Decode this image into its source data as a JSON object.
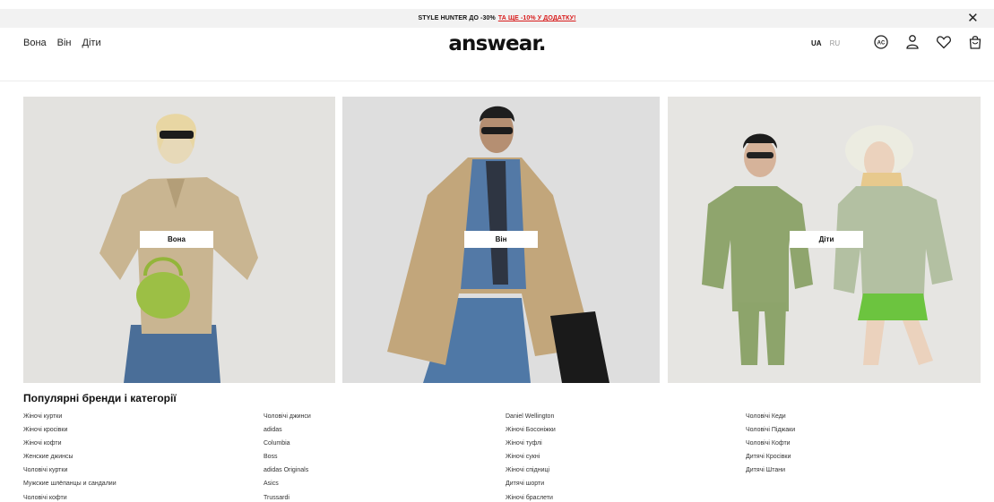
{
  "promo": {
    "text": "STYLE HUNTER ДО -30%",
    "link": "ТА ЩЕ -10% У ДОДАТКУ!",
    "close": "✕"
  },
  "header": {
    "nav": [
      "Вона",
      "Він",
      "Діти"
    ],
    "logo": "answear.",
    "lang_active": "UA",
    "lang_inactive": "RU",
    "icons": [
      "ac-club-icon",
      "user-icon",
      "heart-icon",
      "bag-icon"
    ]
  },
  "hero": {
    "women_label": "Вона",
    "men_label": "Він",
    "kids_label": "Діти"
  },
  "popular": {
    "title": "Популярні бренди і категорії",
    "col1": [
      "Жіночі куртки",
      "Жіночі кросівки",
      "Жіночі кофти",
      "Женские джинсы",
      "Чоловічі куртки",
      "Мужские шлёпанцы и сандалии",
      "Чоловічі кофти"
    ],
    "col2": [
      "Чоловічі джинси",
      "adidas",
      "Columbia",
      "Boss",
      "adidas Originals",
      "Asics",
      "Trussardi"
    ],
    "col3": [
      "Daniel Wellington",
      "Жіночі Босоніжки",
      "Жіночі туфлі",
      "Жіночі сукні",
      "Жіночі спідниці",
      "Дитячі шорти",
      "Жіночі браслети"
    ],
    "col4": [
      "Чоловічі Кеди",
      "Чоловічі Піджаки",
      "Чоловічі Кофти",
      "Дитячі Кросівки",
      "Дитячі Штани"
    ]
  },
  "colors": {
    "promo_bg": "#f2f2f2",
    "promo_link": "#d81b1b",
    "tile_bg": "#e2e1de"
  }
}
